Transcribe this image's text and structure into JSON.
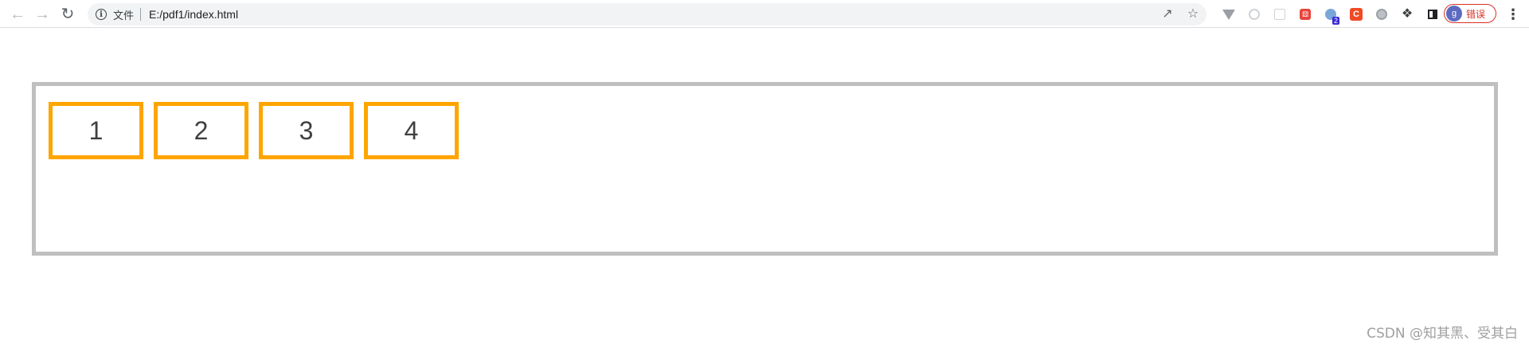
{
  "browser": {
    "site_label": "文件",
    "url": "E:/pdf1/index.html",
    "profile_initial": "g",
    "profile_status": "错误",
    "extension_badge": "2",
    "extension_c_label": "C"
  },
  "icons": {
    "back": "arrow-left-icon",
    "forward": "arrow-right-icon",
    "reload": "reload-icon",
    "site_info": "info-icon",
    "share": "share-icon",
    "bookmark": "star-icon",
    "extensions": "puzzle-icon",
    "side_panel": "side-panel-icon",
    "menu": "kebab-menu-icon"
  },
  "colors": {
    "box_border": "#ffa500",
    "container_border": "#bfbfbf",
    "profile_error": "#d93025"
  },
  "content": {
    "boxes": [
      "1",
      "2",
      "3",
      "4"
    ]
  },
  "watermark": "CSDN @知其黑、受其白"
}
